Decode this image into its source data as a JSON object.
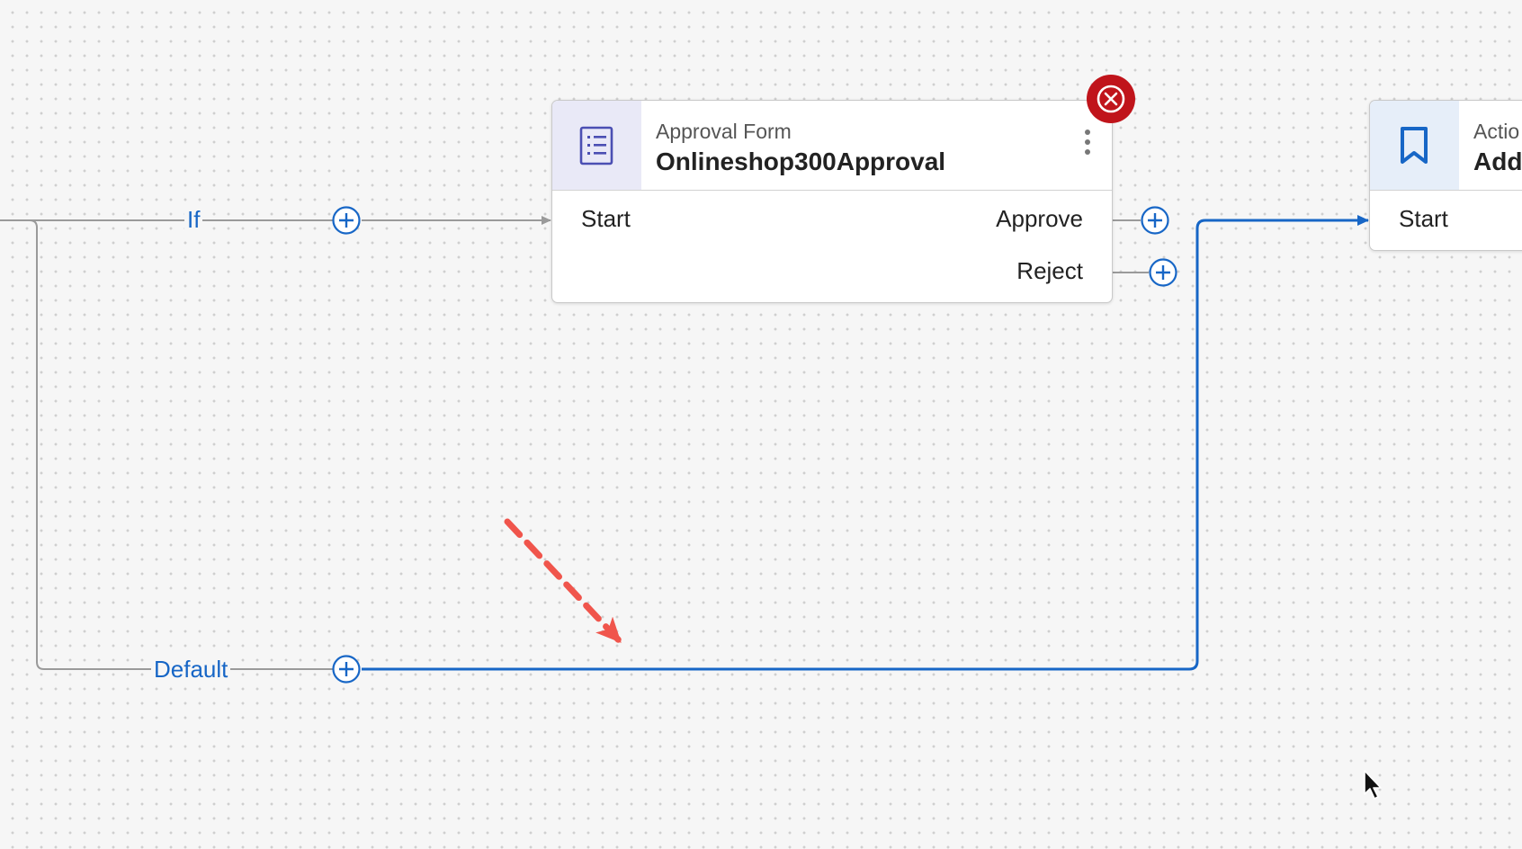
{
  "edges": {
    "if_label": "If",
    "default_label": "Default"
  },
  "approval_node": {
    "type": "Approval Form",
    "name": "Onlineshop300Approval",
    "input_port": "Start",
    "outputs": [
      "Approve",
      "Reject"
    ],
    "icon": "form-list-icon",
    "remove_icon": "close-circle-icon"
  },
  "action_node": {
    "type": "Actio",
    "name": "Add",
    "input_port": "Start",
    "icon": "bookmark-icon"
  },
  "colors": {
    "accent": "#1766c6",
    "connector_gray": "#9a9a9a",
    "delete_red": "#c0141b",
    "annotation_arrow": "#f0554c",
    "form_icon": "#4b4fb3"
  }
}
